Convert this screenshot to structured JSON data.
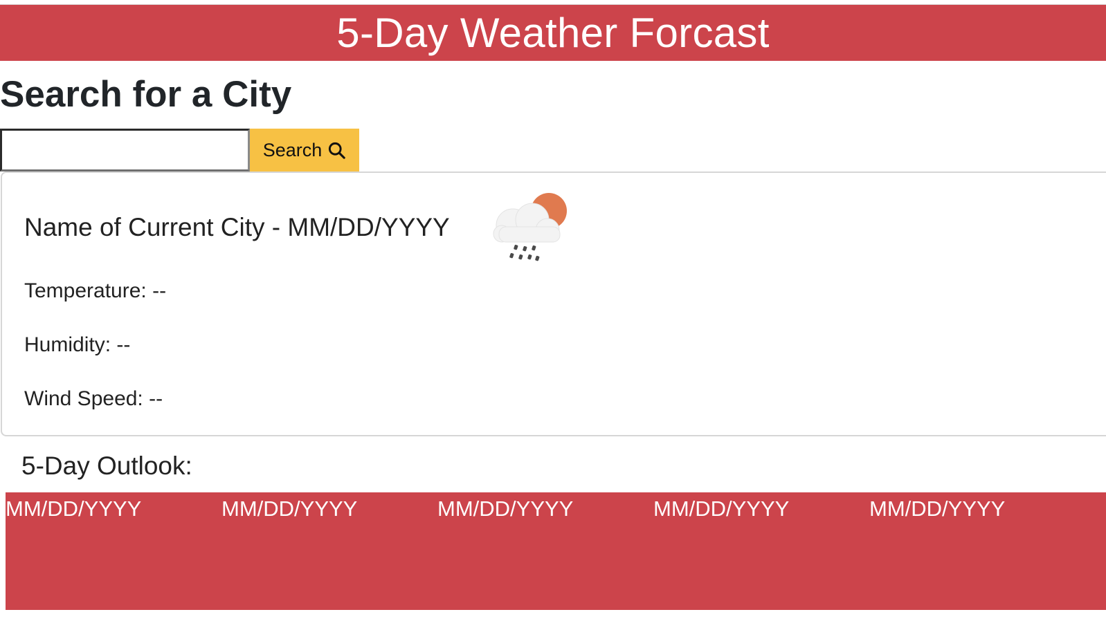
{
  "header": {
    "title": "5-Day Weather Forcast"
  },
  "search": {
    "heading": "Search for a City",
    "input_value": "",
    "button_label": "Search",
    "button_icon": "search-icon"
  },
  "current": {
    "title": "Name of Current City - MM/DD/YYYY",
    "icon": "cloud-sun-rain-icon",
    "temperature": "Temperature: --",
    "humidity": "Humidity: --",
    "wind_speed": "Wind Speed: --"
  },
  "outlook": {
    "heading": "5-Day Outlook:",
    "days": [
      {
        "date": "MM/DD/YYYY"
      },
      {
        "date": "MM/DD/YYYY"
      },
      {
        "date": "MM/DD/YYYY"
      },
      {
        "date": "MM/DD/YYYY"
      },
      {
        "date": "MM/DD/YYYY"
      }
    ]
  },
  "colors": {
    "header_bg": "#cc444b",
    "button_bg": "#f7c144",
    "forecast_bg": "#cc444b",
    "sun": "#e07a4f"
  }
}
